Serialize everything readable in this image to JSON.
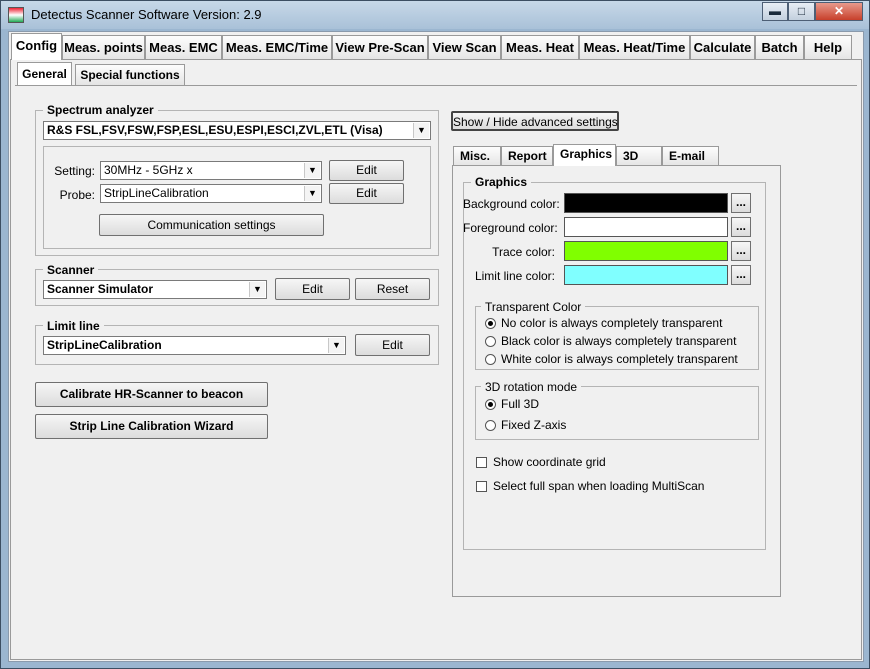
{
  "window": {
    "title": "Detectus Scanner Software Version: 2.9",
    "minimize": "▬",
    "maximize": "□",
    "close": "✕"
  },
  "main_tabs": [
    "Config",
    "Meas. points",
    "Meas. EMC",
    "Meas. EMC/Time",
    "View Pre-Scan",
    "View Scan",
    "Meas. Heat",
    "Meas. Heat/Time",
    "Calculate",
    "Batch",
    "Help"
  ],
  "sub_tabs": [
    "General",
    "Special functions"
  ],
  "spectrum": {
    "label": "Spectrum analyzer",
    "device": "R&S FSL,FSV,FSW,FSP,ESL,ESU,ESPI,ESCI,ZVL,ETL (Visa)",
    "setting_label": "Setting:",
    "setting_value": "30MHz - 5GHz x",
    "probe_label": "Probe:",
    "probe_value": "StripLineCalibration",
    "edit": "Edit",
    "comm": "Communication settings"
  },
  "scanner": {
    "label": "Scanner",
    "value": "Scanner Simulator",
    "edit": "Edit",
    "reset": "Reset"
  },
  "limit": {
    "label": "Limit line",
    "value": "StripLineCalibration",
    "edit": "Edit"
  },
  "actions": {
    "calibrate": "Calibrate HR-Scanner to beacon",
    "wizard": "Strip Line Calibration Wizard"
  },
  "advanced": {
    "toggle": "Show / Hide advanced settings",
    "tabs": [
      "Misc.",
      "Report",
      "Graphics",
      "3D",
      "E-mail"
    ],
    "graphics_label": "Graphics",
    "colors": [
      {
        "label": "Background color:",
        "color": "#000000"
      },
      {
        "label": "Foreground color:",
        "color": "#ffffff"
      },
      {
        "label": "Trace color:",
        "color": "#80ff00"
      },
      {
        "label": "Limit line color:",
        "color": "#80ffff"
      }
    ],
    "dots": "...",
    "transparent": {
      "label": "Transparent Color",
      "options": [
        "No color is always completely transparent",
        "Black color is always completely transparent",
        "White color is always completely transparent"
      ],
      "selected": 0
    },
    "rotation": {
      "label": "3D rotation mode",
      "options": [
        "Full 3D",
        "Fixed Z-axis"
      ],
      "selected": 0
    },
    "checks": [
      "Show coordinate grid",
      "Select full span when loading MultiScan"
    ]
  }
}
